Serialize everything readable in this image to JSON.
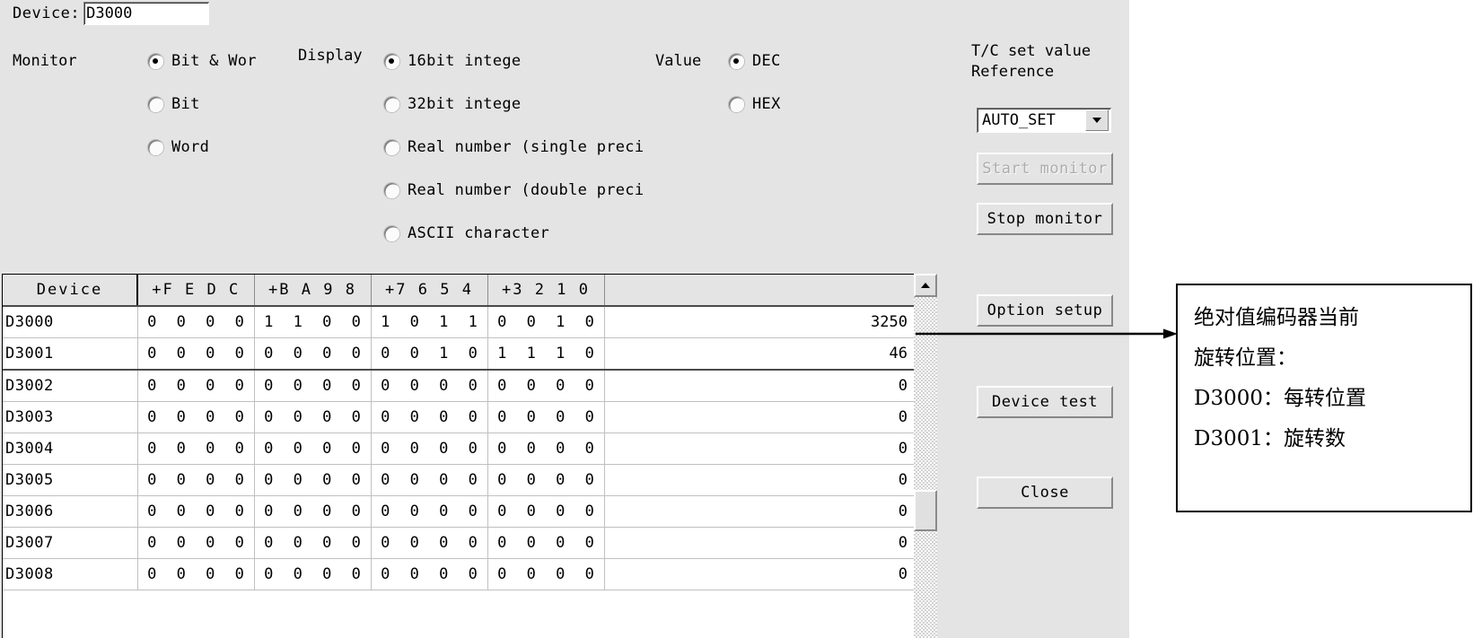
{
  "device": {
    "label": "Device:",
    "value": "D3000"
  },
  "monitor": {
    "label": "Monitor",
    "options": [
      {
        "text": "Bit & Wor",
        "selected": true
      },
      {
        "text": "Bit",
        "selected": false
      },
      {
        "text": "Word",
        "selected": false
      }
    ]
  },
  "display": {
    "label": "Display",
    "options": [
      {
        "text": "16bit intege",
        "selected": true
      },
      {
        "text": "32bit intege",
        "selected": false
      },
      {
        "text": "Real number (single preci",
        "selected": false
      },
      {
        "text": "Real number (double preci",
        "selected": false
      },
      {
        "text": "ASCII character",
        "selected": false
      }
    ]
  },
  "value_format": {
    "label": "Value",
    "options": [
      {
        "text": "DEC",
        "selected": true
      },
      {
        "text": "HEX",
        "selected": false
      }
    ]
  },
  "right_panel": {
    "title_line1": "T/C set value",
    "title_line2": "Reference",
    "combo_value": "AUTO_SET",
    "buttons": [
      {
        "label": "Start monitor",
        "disabled": true
      },
      {
        "label": "Stop monitor",
        "disabled": false
      },
      {
        "label": "Option setup",
        "disabled": false
      },
      {
        "label": "Device test",
        "disabled": false
      },
      {
        "label": "Close",
        "disabled": false
      }
    ]
  },
  "table": {
    "headers": [
      "Device",
      "+F E D C",
      "+B A 9 8",
      "+7 6 5 4",
      "+3 2 1 0",
      ""
    ],
    "rows": [
      {
        "device": "D3000",
        "b1": "0 0 0 0",
        "b2": "1 1 0 0",
        "b3": "1 0 1 1",
        "b4": "0 0 1 0",
        "value": "3250"
      },
      {
        "device": "D3001",
        "b1": "0 0 0 0",
        "b2": "0 0 0 0",
        "b3": "0 0 1 0",
        "b4": "1 1 1 0",
        "value": "46"
      },
      {
        "device": "D3002",
        "b1": "0 0 0 0",
        "b2": "0 0 0 0",
        "b3": "0 0 0 0",
        "b4": "0 0 0 0",
        "value": "0"
      },
      {
        "device": "D3003",
        "b1": "0 0 0 0",
        "b2": "0 0 0 0",
        "b3": "0 0 0 0",
        "b4": "0 0 0 0",
        "value": "0"
      },
      {
        "device": "D3004",
        "b1": "0 0 0 0",
        "b2": "0 0 0 0",
        "b3": "0 0 0 0",
        "b4": "0 0 0 0",
        "value": "0"
      },
      {
        "device": "D3005",
        "b1": "0 0 0 0",
        "b2": "0 0 0 0",
        "b3": "0 0 0 0",
        "b4": "0 0 0 0",
        "value": "0"
      },
      {
        "device": "D3006",
        "b1": "0 0 0 0",
        "b2": "0 0 0 0",
        "b3": "0 0 0 0",
        "b4": "0 0 0 0",
        "value": "0"
      },
      {
        "device": "D3007",
        "b1": "0 0 0 0",
        "b2": "0 0 0 0",
        "b3": "0 0 0 0",
        "b4": "0 0 0 0",
        "value": "0"
      },
      {
        "device": "D3008",
        "b1": "0 0 0 0",
        "b2": "0 0 0 0",
        "b3": "0 0 0 0",
        "b4": "0 0 0 0",
        "value": "0"
      }
    ]
  },
  "annotation": {
    "lines": [
      "绝对值编码器当前",
      "旋转位置：",
      "D3000：每转位置",
      "D3001：旋转数"
    ]
  }
}
